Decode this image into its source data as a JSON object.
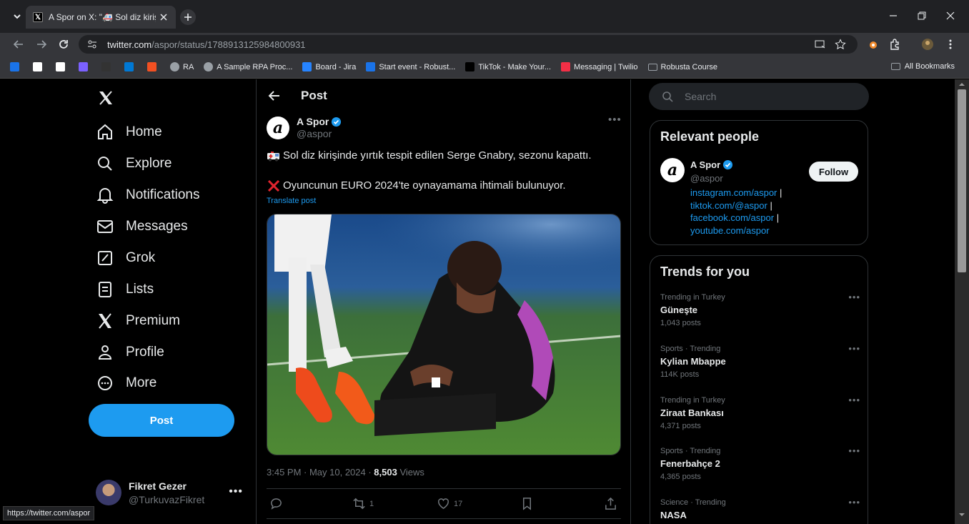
{
  "browser": {
    "tab_title": "A Spor on X: \"🚑 Sol diz kirişinde",
    "url_host": "twitter.com",
    "url_path": "/aspor/status/1788913125984800931",
    "bookmarks": [
      {
        "label": "",
        "icon": "diamond-icon",
        "color": "#1a73e8"
      },
      {
        "label": "",
        "icon": "square-icon",
        "color": "#ffffff"
      },
      {
        "label": "",
        "icon": "x-icon",
        "color": "#ffffff"
      },
      {
        "label": "",
        "icon": "app-icon",
        "color": "#7b61ff"
      },
      {
        "label": "",
        "icon": "github-icon",
        "color": "#333333"
      },
      {
        "label": "",
        "icon": "outlook-icon",
        "color": "#0078d4"
      },
      {
        "label": "",
        "icon": "ms-icon",
        "color": "#f25022"
      },
      {
        "label": "RA",
        "icon": "globe-icon",
        "color": "#9aa0a6"
      },
      {
        "label": "A Sample RPA Proc...",
        "icon": "globe-icon",
        "color": "#9aa0a6"
      },
      {
        "label": "Board - Jira",
        "icon": "jira-icon",
        "color": "#2684ff"
      },
      {
        "label": "Start event - Robust...",
        "icon": "cloud-icon",
        "color": "#1a73e8"
      },
      {
        "label": "TikTok - Make Your...",
        "icon": "tiktok-icon",
        "color": "#000000"
      },
      {
        "label": "Messaging | Twilio",
        "icon": "twilio-icon",
        "color": "#f22f46"
      },
      {
        "label": "Robusta Course",
        "icon": "folder-icon",
        "color": "#9aa0a6"
      }
    ],
    "all_bookmarks": "All Bookmarks",
    "status_url": "https://twitter.com/aspor"
  },
  "nav": {
    "items": [
      {
        "label": "Home",
        "icon": "home-icon"
      },
      {
        "label": "Explore",
        "icon": "search-icon"
      },
      {
        "label": "Notifications",
        "icon": "bell-icon"
      },
      {
        "label": "Messages",
        "icon": "envelope-icon"
      },
      {
        "label": "Grok",
        "icon": "grok-icon"
      },
      {
        "label": "Lists",
        "icon": "list-icon"
      },
      {
        "label": "Premium",
        "icon": "x-icon"
      },
      {
        "label": "Profile",
        "icon": "person-icon"
      },
      {
        "label": "More",
        "icon": "more-circle-icon"
      }
    ],
    "post_button": "Post",
    "account": {
      "name": "Fikret Gezer",
      "handle": "@TurkuvazFikret"
    }
  },
  "post": {
    "header": "Post",
    "author_name": "A Spor",
    "author_handle": "@aspor",
    "line1": "Sol diz kirişinde yırtık tespit edilen Serge Gnabry, sezonu kapattı.",
    "line2": "Oyuncunun EURO 2024'te oynayamama ihtimali bulunuyor.",
    "translate": "Translate post",
    "time": "3:45 PM · May 10, 2024 · ",
    "views_count": "8,503",
    "views_label": " Views",
    "reposts": "1",
    "likes": "17"
  },
  "sidebar": {
    "search_placeholder": "Search",
    "relevant_title": "Relevant people",
    "person": {
      "name": "A Spor",
      "handle": "@aspor",
      "follow": "Follow",
      "links": [
        "instagram.com/aspor",
        "tiktok.com/@aspor",
        "facebook.com/aspor",
        "youtube.com/aspor"
      ],
      "sep": "|"
    },
    "trends_title": "Trends for you",
    "trends": [
      {
        "context": "Trending in Turkey",
        "name": "Güneşte",
        "posts": "1,043 posts"
      },
      {
        "context": "Sports · Trending",
        "name": "Kylian Mbappe",
        "posts": "114K posts"
      },
      {
        "context": "Trending in Turkey",
        "name": "Ziraat Bankası",
        "posts": "4,371 posts"
      },
      {
        "context": "Sports · Trending",
        "name": "Fenerbahçe 2",
        "posts": "4,365 posts"
      },
      {
        "context": "Science · Trending",
        "name": "NASA",
        "posts": ""
      }
    ]
  }
}
